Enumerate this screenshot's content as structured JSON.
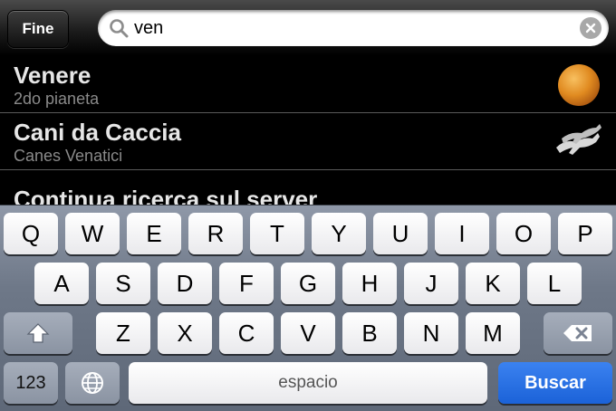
{
  "search": {
    "done_label": "Fine",
    "query": "ven"
  },
  "results": [
    {
      "title": "Venere",
      "subtitle": "2do pianeta",
      "icon": "planet-venus-icon"
    },
    {
      "title": "Cani da Caccia",
      "subtitle": "Canes Venatici",
      "icon": "hunting-dogs-constellation-icon"
    }
  ],
  "server_search_label": "Continua ricerca sul server",
  "keyboard": {
    "row1": [
      "Q",
      "W",
      "E",
      "R",
      "T",
      "Y",
      "U",
      "I",
      "O",
      "P"
    ],
    "row2": [
      "A",
      "S",
      "D",
      "F",
      "G",
      "H",
      "J",
      "K",
      "L"
    ],
    "row3": [
      "Z",
      "X",
      "C",
      "V",
      "B",
      "N",
      "M"
    ],
    "numbers_label": "123",
    "space_label": "espacio",
    "search_label": "Buscar"
  },
  "colors": {
    "search_key": "#1b62d8",
    "keyboard_bg": "#6e7888"
  }
}
